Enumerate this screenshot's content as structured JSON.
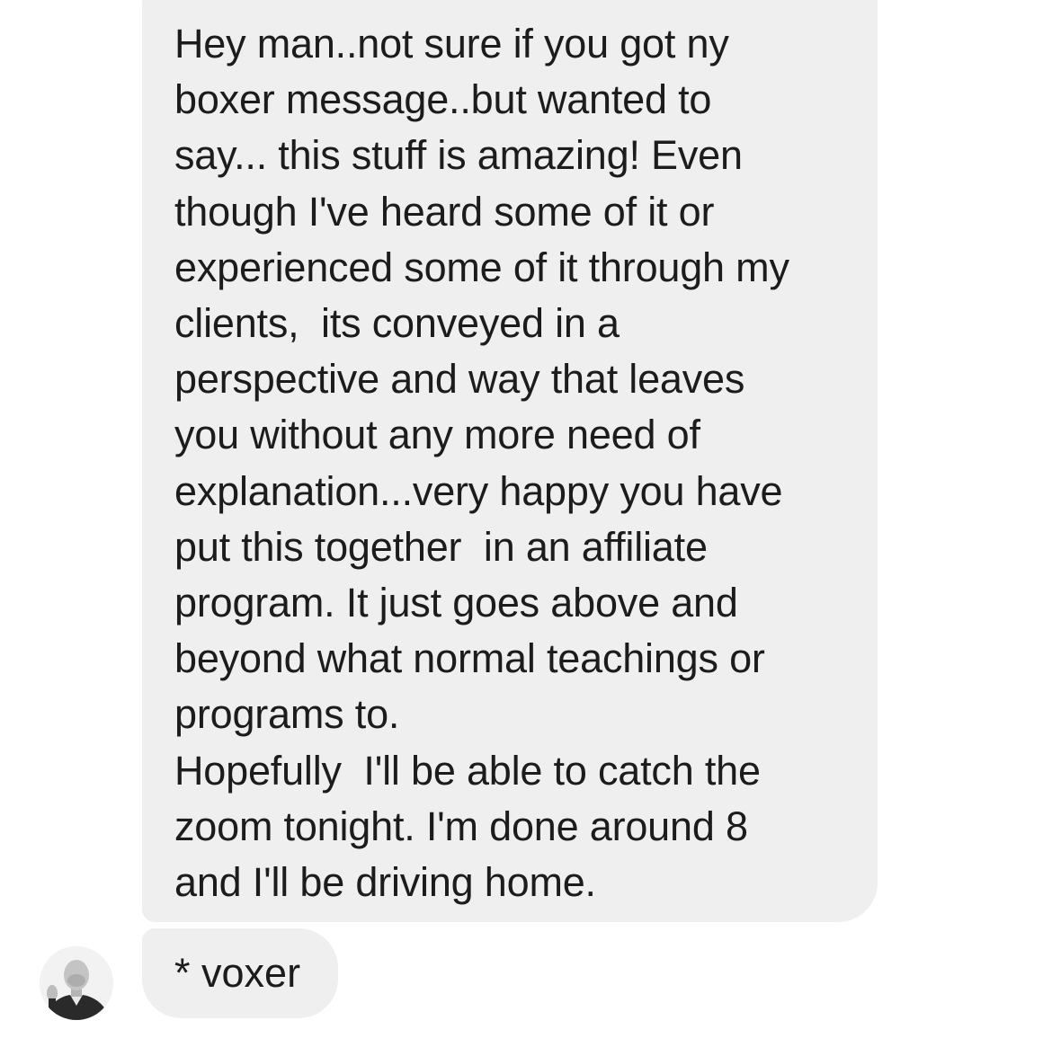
{
  "thread": {
    "message_lines": [
      "Hey man..not sure if you got ny",
      "boxer message..but wanted to",
      "say... this stuff is amazing! Even",
      "though I've heard some of it or",
      "experienced some of it through my",
      "clients,  its conveyed in a",
      "perspective and way that leaves",
      "you without any more need of",
      "explanation...very happy you have",
      "put this together  in an affiliate",
      "program. It just goes above and",
      "beyond what normal teachings or",
      "programs to.",
      "Hopefully  I'll be able to catch the",
      "zoom tonight. I'm done around 8",
      "and I'll be driving home."
    ],
    "followup_message": "* voxer",
    "avatar_icon": "user-avatar-photo",
    "bubble_color": "#efefef"
  }
}
